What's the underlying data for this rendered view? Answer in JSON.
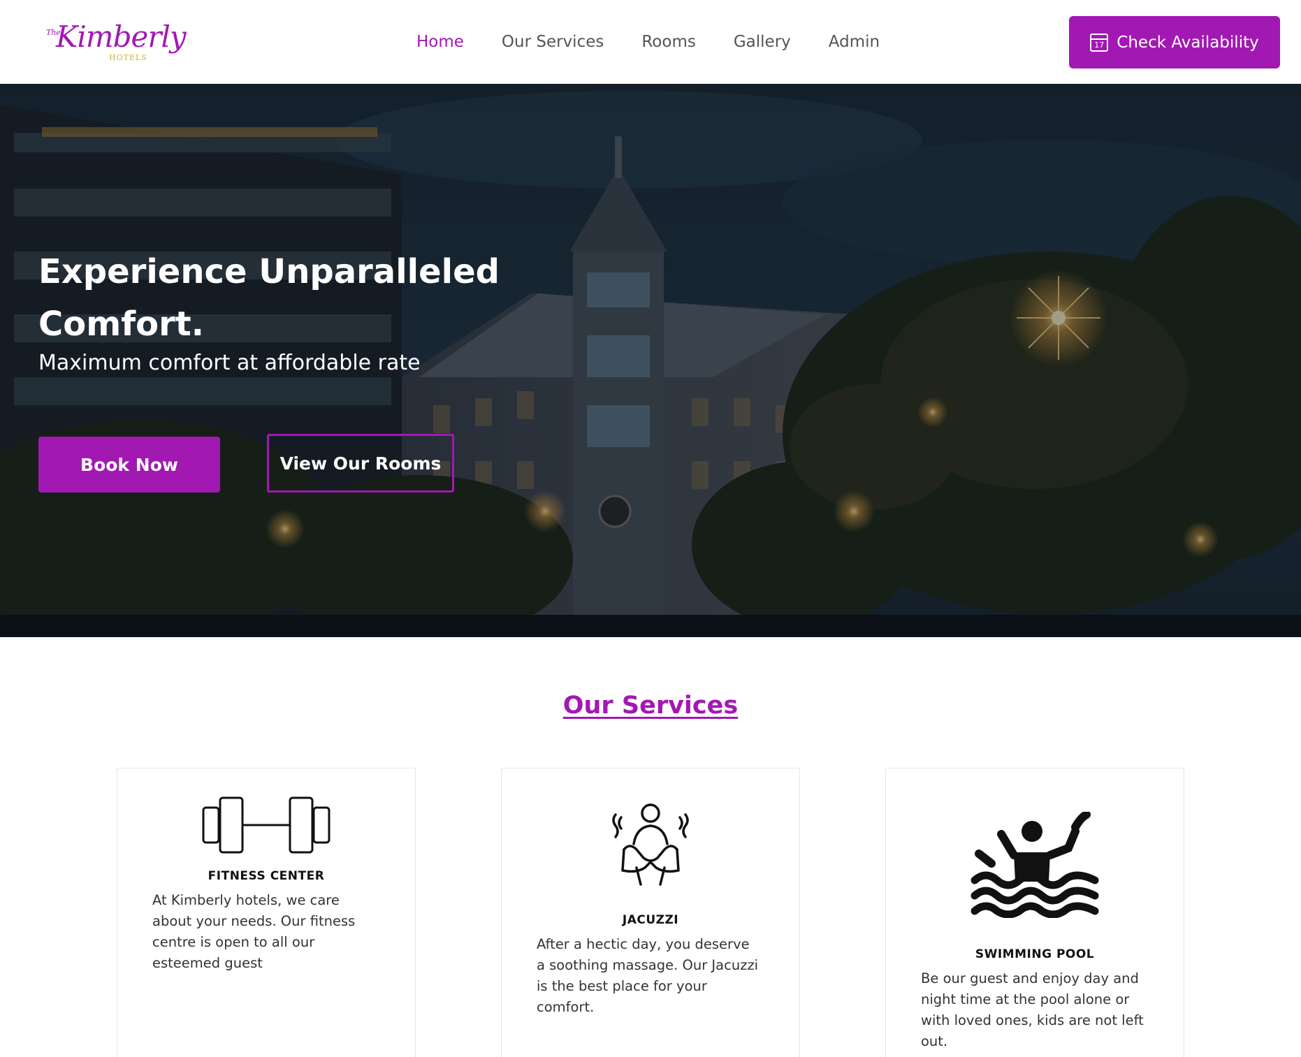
{
  "brand": {
    "logo_the": "The",
    "logo_name": "Kimberly",
    "logo_sub": "HOTELS"
  },
  "nav": {
    "items": [
      "Home",
      "Our Services",
      "Rooms",
      "Gallery",
      "Admin"
    ],
    "active": "Home"
  },
  "header": {
    "cta_label": "Check Availability",
    "cta_icon": "calendar-icon",
    "cta_icon_day": "17"
  },
  "hero": {
    "title": "Experience Unparalleled Comfort.",
    "subtitle": "Maximum comfort at affordable rate",
    "book_label": "Book Now",
    "rooms_label": "View Our Rooms"
  },
  "services": {
    "heading": "Our Services",
    "cards": [
      {
        "icon": "dumbbell-icon",
        "title": "FITNESS CENTER",
        "text": "At Kimberly hotels, we care about your needs. Our fitness centre is open to all our esteemed guest"
      },
      {
        "icon": "jacuzzi-icon",
        "title": "JACUZZI",
        "text": "After a hectic day, you deserve a soothing massage. Our Jacuzzi is the best place for your comfort."
      },
      {
        "icon": "swimmer-icon",
        "title": "SWIMMING POOL",
        "text": "Be our guest and enjoy day and night time at the pool alone or with loved ones, kids are not left out."
      }
    ]
  },
  "colors": {
    "brand": "#a218b3",
    "logo_gold": "#d4b12a",
    "text": "#333333",
    "card_border": "#e1e7ef"
  }
}
